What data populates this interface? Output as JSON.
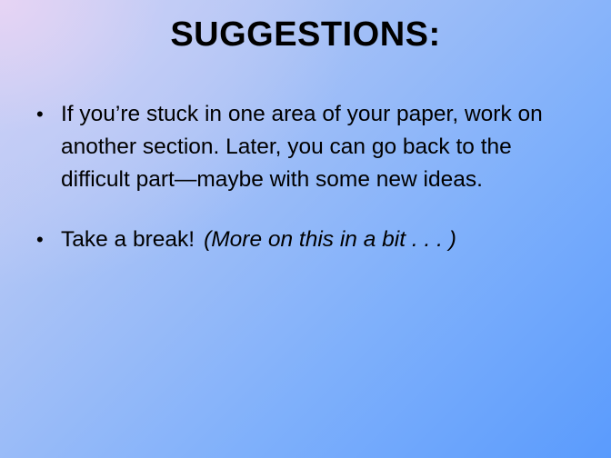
{
  "slide": {
    "title": "SUGGESTIONS:",
    "bullets": [
      {
        "text": "If you’re stuck in one area of your paper, work on another section.  Later, you can go back to the difficult part—maybe with some new ideas."
      },
      {
        "text": "Take a break!",
        "note": "(More on this in a bit . . . )"
      }
    ]
  }
}
